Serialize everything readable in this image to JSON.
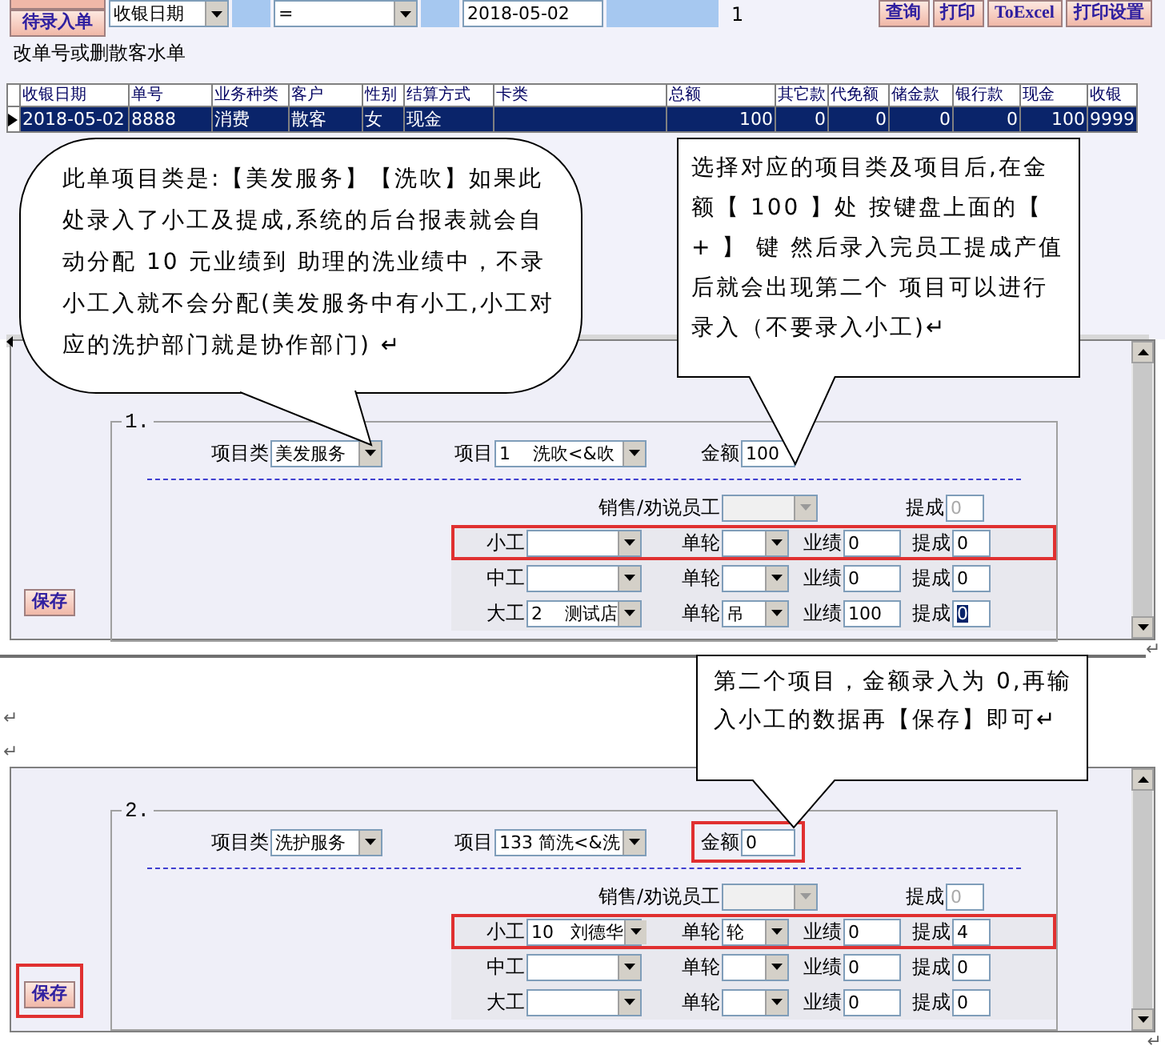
{
  "toolbar": {
    "buttons_left": [
      {
        "label": "待录入单"
      }
    ],
    "filters": [
      {
        "kind": "select",
        "value": "收银日期"
      },
      {
        "kind": "blank"
      },
      {
        "kind": "select",
        "value": "="
      },
      {
        "kind": "blank"
      },
      {
        "kind": "input",
        "value": "2018-05-02"
      },
      {
        "kind": "blank"
      }
    ],
    "count": "1",
    "buttons_right": [
      {
        "label": "查询"
      },
      {
        "label": "打印"
      },
      {
        "label": "ToExcel"
      },
      {
        "label": "打印设置"
      }
    ]
  },
  "hint": "改单号或删散客水单",
  "table": {
    "columns": [
      "收银日期",
      "单号",
      "业务种类",
      "客户",
      "性别",
      "结算方式",
      "卡类",
      "总额",
      "其它款",
      "代免额",
      "储金款",
      "银行款",
      "现金",
      "收银"
    ],
    "rows": [
      {
        "selected": true,
        "cells": [
          "2018-05-02",
          "8888",
          "消费",
          "散客",
          "女",
          "现金",
          "",
          "100",
          "0",
          "0",
          "0",
          "0",
          "100",
          "9999"
        ]
      }
    ]
  },
  "callouts": [
    {
      "kind": "rounded",
      "text": "此单项目类是:【美发服务】【洗吹】如果此处录入了小工及提成,系统的后台报表就会自动分配 10 元业绩到 助理的洗业绩中，不录小工入就不会分配(美发服务中有小工,小工对应的洗护部门就是协作部门) ↵"
    },
    {
      "kind": "box",
      "text": "选择对应的项目类及项目后,在金额【 100 】处 按键盘上面的【 + 】 键 然后录入完员工提成产值后就会出现第二个 项目可以进行录入（不要录入小工)↵"
    },
    {
      "kind": "box",
      "text": "第二个项目，金额录入为 0,再输入小工的数据再【保存】即可↵"
    }
  ],
  "panels": [
    {
      "number": "1.",
      "category": {
        "label": "项目类",
        "value": "美发服务"
      },
      "item": {
        "label": "项目",
        "value": "1    洗吹<&吹"
      },
      "amount": {
        "label": "金额",
        "value": "100",
        "highlighted": false
      },
      "sales": {
        "label": "销售/劝说员工",
        "commission_label": "提成",
        "commission": "0"
      },
      "workers": [
        {
          "label": "小工",
          "round_label": "单轮",
          "perf_label": "业绩",
          "perf": "0",
          "comm_label": "提成",
          "comm": "0",
          "comm_selected": false,
          "highlighted": true
        },
        {
          "label": "中工",
          "round_label": "单轮",
          "perf_label": "业绩",
          "perf": "0",
          "comm_label": "提成",
          "comm": "0",
          "comm_selected": false,
          "highlighted": false
        },
        {
          "label": "大工",
          "staff": "2    测试店",
          "round_label": "单轮",
          "round": "吊",
          "perf_label": "业绩",
          "perf": "100",
          "comm_label": "提成",
          "comm": "0",
          "comm_selected": true,
          "highlighted": false
        }
      ],
      "save": {
        "label": "保存",
        "highlighted": false
      }
    },
    {
      "number": "2.",
      "category": {
        "label": "项目类",
        "value": "洗护服务"
      },
      "item": {
        "label": "项目",
        "value": "133 简洗<&洗"
      },
      "amount": {
        "label": "金额",
        "value": "0",
        "highlighted": true
      },
      "sales": {
        "label": "销售/劝说员工",
        "commission_label": "提成",
        "commission": "0"
      },
      "workers": [
        {
          "label": "小工",
          "staff": "10   刘德华",
          "round_label": "单轮",
          "round": "轮",
          "perf_label": "业绩",
          "perf": "0",
          "comm_label": "提成",
          "comm": "4",
          "comm_selected": false,
          "highlighted": true
        },
        {
          "label": "中工",
          "round_label": "单轮",
          "perf_label": "业绩",
          "perf": "0",
          "comm_label": "提成",
          "comm": "0",
          "comm_selected": false,
          "highlighted": false
        },
        {
          "label": "大工",
          "round_label": "单轮",
          "perf_label": "业绩",
          "perf": "0",
          "comm_label": "提成",
          "comm": "0",
          "comm_selected": false,
          "highlighted": false
        }
      ],
      "save": {
        "label": "保存",
        "highlighted": true
      }
    }
  ],
  "section_break": {
    "mark": "↵"
  },
  "blank_lines": [
    "↵",
    "↵"
  ],
  "end_mark": "↵"
}
